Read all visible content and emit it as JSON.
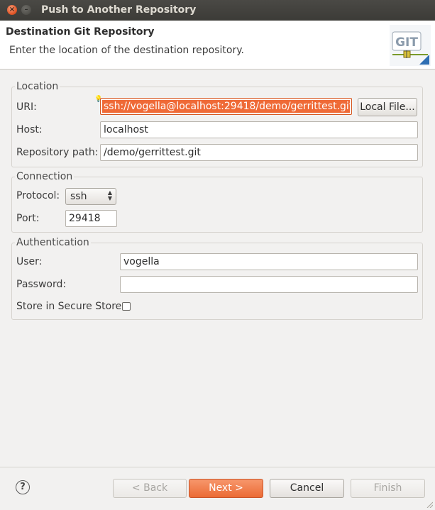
{
  "window": {
    "title": "Push to Another Repository"
  },
  "header": {
    "title": "Destination Git Repository",
    "description": "Enter the location of the destination repository.",
    "logo_text": "GIT"
  },
  "location": {
    "group_label": "Location",
    "uri_label": "URI:",
    "uri_value": "ssh://vogella@localhost:29418/demo/gerrittest.git",
    "local_file_button": "Local File...",
    "host_label": "Host:",
    "host_value": "localhost",
    "repo_path_label": "Repository path:",
    "repo_path_value": "/demo/gerrittest.git"
  },
  "connection": {
    "group_label": "Connection",
    "protocol_label": "Protocol:",
    "protocol_value": "ssh",
    "port_label": "Port:",
    "port_value": "29418"
  },
  "authentication": {
    "group_label": "Authentication",
    "user_label": "User:",
    "user_value": "vogella",
    "password_label": "Password:",
    "password_value": "",
    "store_label": "Store in Secure Store",
    "store_checked": false
  },
  "footer": {
    "back_button": "< Back",
    "next_button": "Next >",
    "cancel_button": "Cancel",
    "finish_button": "Finish"
  },
  "colors": {
    "accent": "#ef6a37",
    "titlebar": "#3c3b37"
  },
  "icons": {
    "help": "question-icon",
    "close": "close-icon",
    "minimize": "minimize-icon"
  }
}
